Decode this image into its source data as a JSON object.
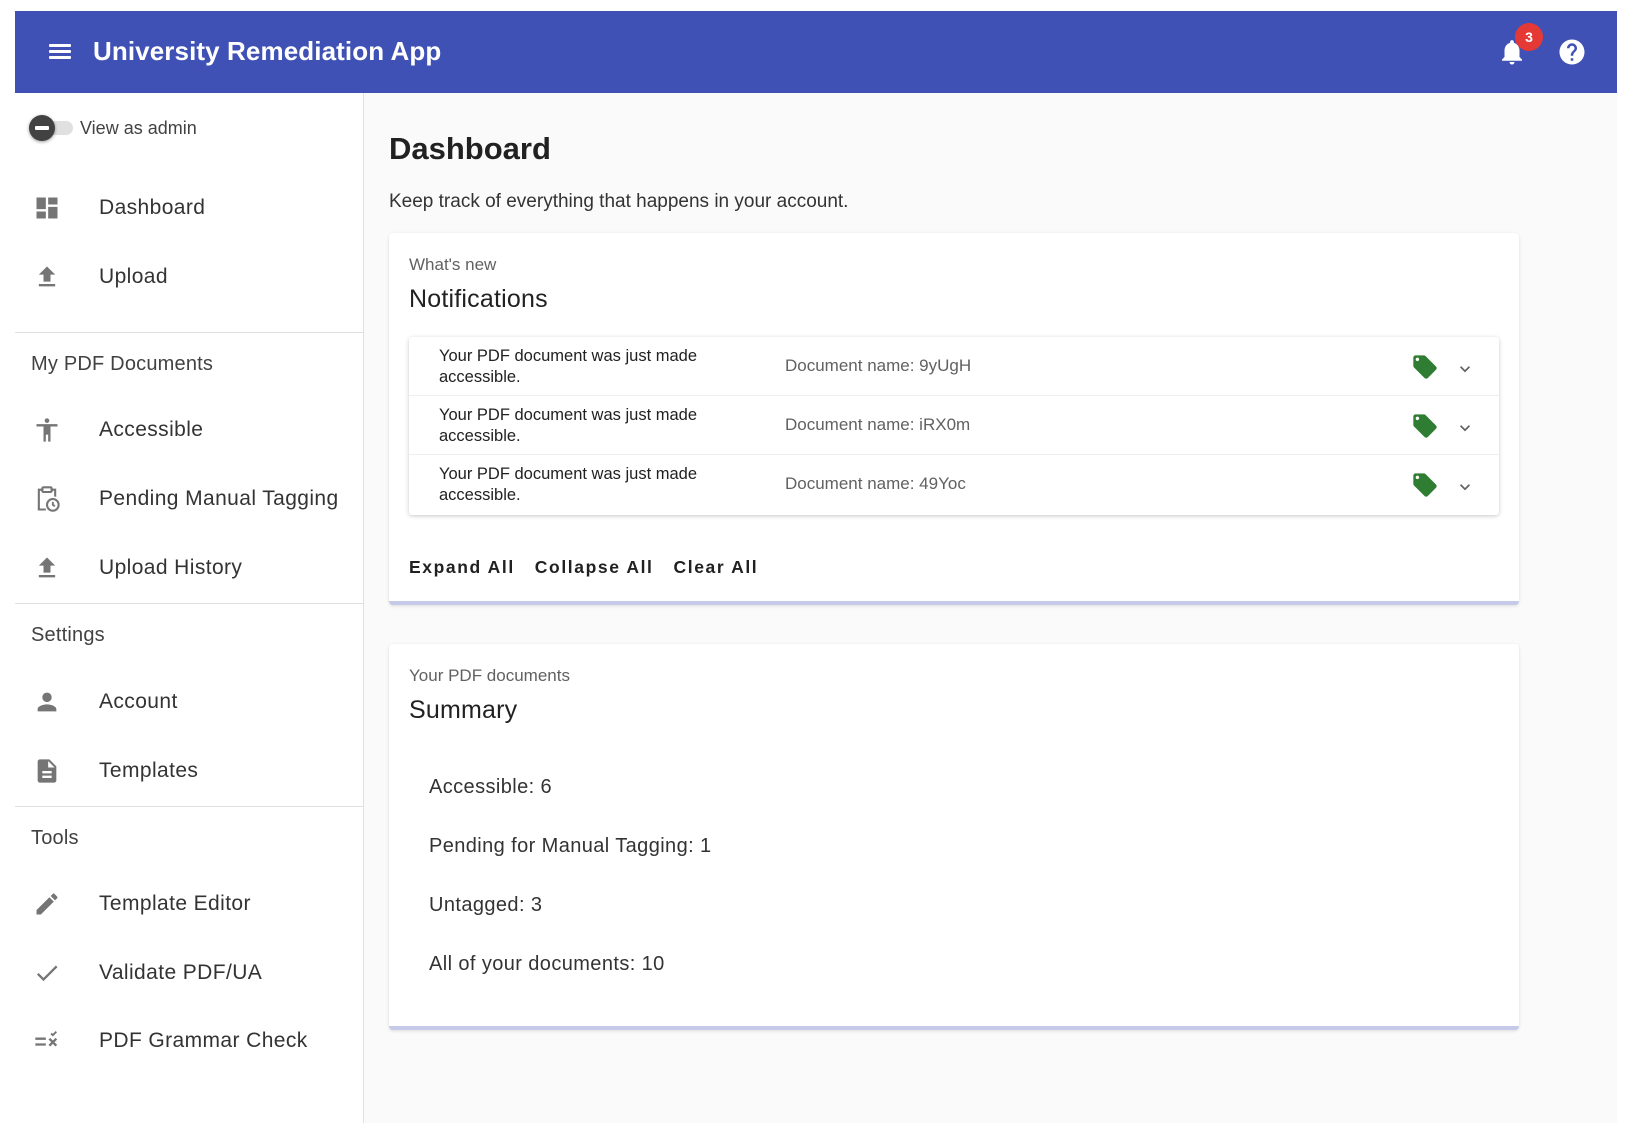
{
  "appbar": {
    "title": "University Remediation App",
    "notification_count": "3",
    "icons": [
      "menu-icon",
      "bell-icon",
      "help-icon"
    ],
    "color": "#3f51b5"
  },
  "sidebar": {
    "toggle_label": "View as admin",
    "top_items": [
      {
        "label": "Dashboard",
        "icon": "dashboard-icon"
      },
      {
        "label": "Upload",
        "icon": "upload-icon"
      }
    ],
    "sections": [
      {
        "header": "My PDF Documents",
        "items": [
          {
            "label": "Accessible",
            "icon": "accessibility-icon"
          },
          {
            "label": "Pending Manual Tagging",
            "icon": "clipboard-clock-icon"
          },
          {
            "label": "Upload History",
            "icon": "upload-icon"
          }
        ]
      },
      {
        "header": "Settings",
        "items": [
          {
            "label": "Account",
            "icon": "person-icon"
          },
          {
            "label": "Templates",
            "icon": "document-icon"
          }
        ]
      },
      {
        "header": "Tools",
        "items": [
          {
            "label": "Template Editor",
            "icon": "pencil-icon"
          },
          {
            "label": "Validate PDF/UA",
            "icon": "check-icon"
          },
          {
            "label": "PDF Grammar Check",
            "icon": "spellcheck-icon"
          }
        ]
      }
    ]
  },
  "main": {
    "title": "Dashboard",
    "subtitle": "Keep track of everything that happens in your account.",
    "notifications": {
      "overline": "What's new",
      "heading": "Notifications",
      "items": [
        {
          "message": "Your PDF document was just made accessible.",
          "document": "Document name: 9yUgH"
        },
        {
          "message": "Your PDF document was just made accessible.",
          "document": "Document name: iRX0m"
        },
        {
          "message": "Your PDF document was just made accessible.",
          "document": "Document name: 49Yoc"
        }
      ],
      "actions": [
        "Expand All",
        "Collapse All",
        "Clear All"
      ],
      "tag_color": "#2e7d32"
    },
    "summary": {
      "overline": "Your PDF documents",
      "heading": "Summary",
      "lines": [
        "Accessible: 6",
        "Pending for Manual Tagging: 1",
        "Untagged: 3",
        "All of your documents: 10"
      ]
    }
  }
}
